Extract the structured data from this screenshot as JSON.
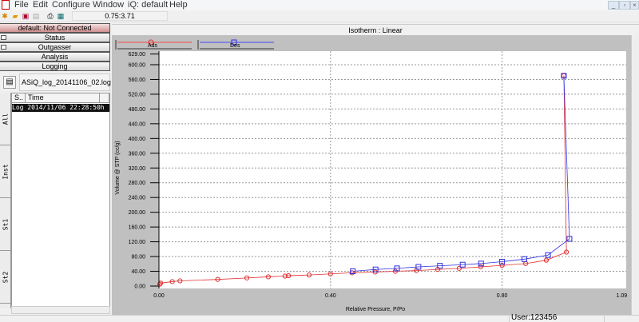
{
  "menu": {
    "items": [
      "File",
      "Edit",
      "Configure",
      "Window",
      "iQ: default",
      "Help"
    ]
  },
  "window_controls": {
    "minimize": "_",
    "restore": "▫",
    "close": "×"
  },
  "toolbar": {
    "coordinate_readout": "0.75:3.71"
  },
  "left_panel": {
    "connection": "default: Not Connected",
    "sections": [
      "Status",
      "Outgasser",
      "Analysis",
      "Logging"
    ],
    "log_file": "ASiQ_log_20141106_02.log",
    "columns": [
      "S..",
      "Time"
    ],
    "selected_row": "Log 2014/11/06 22:28:50h",
    "vertical_tabs": [
      "All",
      "Inst",
      "St1",
      "St2"
    ]
  },
  "chart_title": "Isotherm : Linear",
  "status": {
    "user": "User:123456"
  },
  "chart_data": {
    "type": "line",
    "xlabel": "Relative Pressure, P/Po",
    "ylabel": "Volume @ STP (cc/g)",
    "xlim": [
      0,
      1.09
    ],
    "ylim": [
      0,
      629
    ],
    "x_ticks": [
      "0.00",
      "0.40",
      "0.80",
      "1.09"
    ],
    "x_tick_values": [
      0,
      0.4,
      0.8,
      1.09
    ],
    "y_ticks": [
      "0.00",
      "40.00",
      "80.00",
      "120.00",
      "160.00",
      "200.00",
      "240.00",
      "280.00",
      "320.00",
      "360.00",
      "400.00",
      "440.00",
      "480.00",
      "520.00",
      "560.00",
      "600.00",
      "629.00"
    ],
    "y_tick_values": [
      0,
      40,
      80,
      120,
      160,
      200,
      240,
      280,
      320,
      360,
      400,
      440,
      480,
      520,
      560,
      600,
      629
    ],
    "grid": true,
    "legend_position": "top",
    "colors": {
      "ads": "#e03030",
      "des": "#3030e0"
    },
    "series": [
      {
        "name": "Ads",
        "marker": "circle",
        "x": [
          0.002,
          0.004,
          0.031,
          0.049,
          0.137,
          0.205,
          0.255,
          0.294,
          0.302,
          0.35,
          0.4,
          0.45,
          0.504,
          0.551,
          0.6,
          0.65,
          0.7,
          0.75,
          0.8,
          0.855,
          0.903,
          0.95,
          0.944
        ],
        "y": [
          5,
          8,
          12,
          14,
          18,
          22,
          25,
          27,
          28,
          30,
          33,
          36,
          38,
          40,
          42,
          45,
          48,
          52,
          56,
          61,
          70,
          92,
          570
        ]
      },
      {
        "name": "Des",
        "marker": "square",
        "x": [
          0.944,
          0.957,
          0.907,
          0.852,
          0.8,
          0.751,
          0.708,
          0.655,
          0.605,
          0.555,
          0.505,
          0.452
        ],
        "y": [
          570,
          128,
          84,
          73,
          66,
          61,
          58,
          55,
          52,
          48,
          45,
          40
        ]
      }
    ]
  }
}
